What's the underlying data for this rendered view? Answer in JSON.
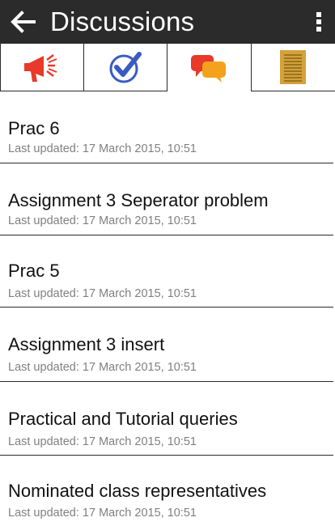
{
  "header": {
    "title": "Discussions",
    "back_icon": "back-arrow-icon",
    "menu_icon": "overflow-menu-icon"
  },
  "tabs": [
    {
      "icon": "megaphone-icon",
      "active": false
    },
    {
      "icon": "checkmark-circle-icon",
      "active": false
    },
    {
      "icon": "chat-bubbles-icon",
      "active": true
    },
    {
      "icon": "notes-page-icon",
      "active": false
    }
  ],
  "colors": {
    "action_bar": "#2b2b2b",
    "megaphone": "#e8392a",
    "check": "#3a5bbf",
    "bubble_red": "#e8392a",
    "bubble_orange": "#f4a21e",
    "notes": "#d4a23a"
  },
  "discussions": [
    {
      "title": "Prac 6",
      "updated": "Last updated: 17 March 2015, 10:51"
    },
    {
      "title": "Assignment 3 Seperator problem",
      "updated": "Last updated: 17 March 2015, 10:51"
    },
    {
      "title": "Prac 5",
      "updated": "Last updated: 17 March 2015, 10:51"
    },
    {
      "title": "Assignment 3 insert",
      "updated": "Last updated: 17 March 2015, 10:51"
    },
    {
      "title": "Practical and Tutorial queries",
      "updated": "Last updated: 17 March 2015, 10:51"
    },
    {
      "title": "Nominated class representatives",
      "updated": "Last updated: 17 March 2015, 10:51"
    }
  ]
}
